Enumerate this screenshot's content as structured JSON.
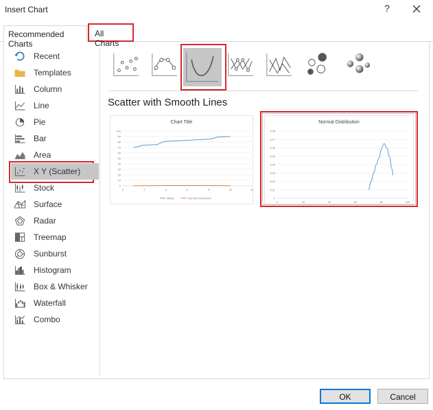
{
  "dialog": {
    "title": "Insert Chart",
    "help_label": "?",
    "close_icon": "close-icon"
  },
  "tabs": [
    {
      "label": "Recommended Charts",
      "selected": false
    },
    {
      "label": "All Charts",
      "selected": true
    }
  ],
  "sidebar": {
    "items": [
      {
        "label": "Recent",
        "icon": "recent-icon"
      },
      {
        "label": "Templates",
        "icon": "folder-icon"
      },
      {
        "label": "Column",
        "icon": "column-chart-icon"
      },
      {
        "label": "Line",
        "icon": "line-chart-icon"
      },
      {
        "label": "Pie",
        "icon": "pie-chart-icon"
      },
      {
        "label": "Bar",
        "icon": "bar-chart-icon"
      },
      {
        "label": "Area",
        "icon": "area-chart-icon"
      },
      {
        "label": "X Y (Scatter)",
        "icon": "scatter-chart-icon",
        "selected": true
      },
      {
        "label": "Stock",
        "icon": "stock-chart-icon"
      },
      {
        "label": "Surface",
        "icon": "surface-chart-icon"
      },
      {
        "label": "Radar",
        "icon": "radar-chart-icon"
      },
      {
        "label": "Treemap",
        "icon": "treemap-chart-icon"
      },
      {
        "label": "Sunburst",
        "icon": "sunburst-chart-icon"
      },
      {
        "label": "Histogram",
        "icon": "histogram-chart-icon"
      },
      {
        "label": "Box & Whisker",
        "icon": "box-whisker-chart-icon"
      },
      {
        "label": "Waterfall",
        "icon": "waterfall-chart-icon"
      },
      {
        "label": "Combo",
        "icon": "combo-chart-icon"
      }
    ]
  },
  "chart_types": [
    {
      "icon": "scatter-icon"
    },
    {
      "icon": "scatter-smooth-lines-markers-icon"
    },
    {
      "icon": "scatter-smooth-lines-icon",
      "selected": true
    },
    {
      "icon": "scatter-straight-lines-markers-icon"
    },
    {
      "icon": "scatter-straight-lines-icon"
    },
    {
      "icon": "bubble-icon"
    },
    {
      "icon": "3d-bubble-icon"
    }
  ],
  "section_title": "Scatter with Smooth Lines",
  "previews": [
    {
      "title": "Chart Title",
      "selected": false,
      "chart_data": {
        "type": "line",
        "ylim": [
          0,
          100
        ],
        "xlim": [
          0,
          12
        ],
        "yticks": [
          "0",
          "10",
          "20",
          "30",
          "40",
          "50",
          "60",
          "70",
          "80",
          "90",
          "100"
        ],
        "xticks": [
          "0",
          "2",
          "4",
          "6",
          "8",
          "10",
          "12"
        ],
        "series": [
          {
            "name": "Marks",
            "color": "#5b9bd5",
            "x": [
              1,
              2,
              3,
              4,
              5,
              6,
              7,
              8,
              9,
              10
            ],
            "y": [
              70,
              74,
              75,
              81,
              82,
              83,
              84,
              85,
              89,
              90
            ]
          },
          {
            "name": "Normal Distribution",
            "color": "#ed7d31",
            "x": [
              1,
              2,
              3,
              4,
              5,
              6,
              7,
              8,
              9,
              10
            ],
            "y": [
              0.2,
              0.3,
              0.4,
              0.6,
              0.7,
              0.7,
              0.6,
              0.5,
              0.4,
              0.3
            ]
          }
        ],
        "legend": "bottom"
      }
    },
    {
      "title": "Normal Distribution",
      "selected": true,
      "chart_data": {
        "type": "line",
        "ylim": [
          0,
          0.08
        ],
        "xlim": [
          0,
          100
        ],
        "yticks": [
          "0",
          "0.01",
          "0.02",
          "0.03",
          "0.04",
          "0.05",
          "0.06",
          "0.07",
          "0.08"
        ],
        "xticks": [
          "0",
          "20",
          "40",
          "60",
          "80",
          "100"
        ],
        "series": [
          {
            "name": "",
            "color": "#5b9bd5",
            "x": [
              70,
              72,
              74,
              76,
              78,
              80,
              81,
              82,
              84,
              86,
              88,
              89
            ],
            "y": [
              0.01,
              0.02,
              0.03,
              0.04,
              0.048,
              0.058,
              0.063,
              0.065,
              0.06,
              0.05,
              0.035,
              0.027
            ]
          }
        ],
        "legend": "none"
      }
    }
  ],
  "buttons": {
    "ok": "OK",
    "cancel": "Cancel"
  }
}
